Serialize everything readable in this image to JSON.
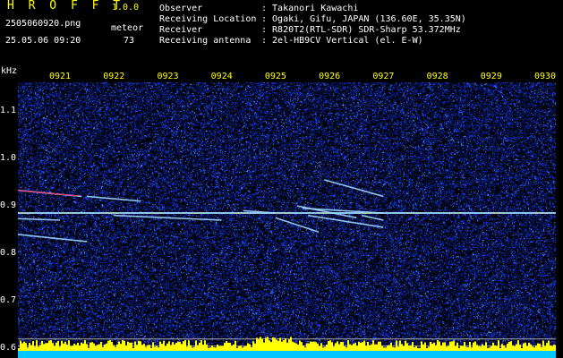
{
  "app": {
    "logo": "H R O F F T",
    "version": "1.0.0",
    "filename": "2505060920.png",
    "datetime": "25.05.06 09:20",
    "meteor_label": "meteor",
    "meteor_count": "73"
  },
  "meta": [
    {
      "label": "Observer",
      "value": ": Takanori Kawachi"
    },
    {
      "label": "Receiving Location",
      "value": ": Ogaki, Gifu, JAPAN (136.60E, 35.35N)"
    },
    {
      "label": "Receiver",
      "value": ": R820T2(RTL-SDR) SDR-Sharp 53.372MHz"
    },
    {
      "label": "Receiving antenna",
      "value": ": 2el-HB9CV Vertical (el. E-W)"
    }
  ],
  "chart_data": {
    "type": "heatmap",
    "ylabel": "kHz",
    "x_ticks": [
      "0921",
      "0922",
      "0923",
      "0924",
      "0925",
      "0926",
      "0927",
      "0928",
      "0929",
      "0930"
    ],
    "y_ticks": [
      "1.1",
      "1.0",
      "0.9",
      "0.8",
      "0.7",
      "0.6"
    ],
    "ylim": [
      0.58,
      1.16
    ],
    "carrier_khz": 0.885,
    "meteor_traces": [
      {
        "t0": 0.92,
        "f0": 0.935,
        "t1": 0.934,
        "f1": 0.92
      },
      {
        "t0": 0.935,
        "f0": 0.92,
        "t1": 0.945,
        "f1": 0.91
      },
      {
        "t0": 0.975,
        "f0": 0.895,
        "t1": 0.99,
        "f1": 0.885
      },
      {
        "t0": 0.918,
        "f0": 0.845,
        "t1": 0.935,
        "f1": 0.825
      },
      {
        "t0": 0.918,
        "f0": 0.875,
        "t1": 0.93,
        "f1": 0.87
      },
      {
        "t0": 0.94,
        "f0": 0.88,
        "t1": 0.96,
        "f1": 0.87
      },
      {
        "t0": 0.964,
        "f0": 0.89,
        "t1": 0.97,
        "f1": 0.885
      },
      {
        "t0": 0.979,
        "f0": 0.955,
        "t1": 0.99,
        "f1": 0.92
      },
      {
        "t0": 0.974,
        "f0": 0.9,
        "t1": 0.985,
        "f1": 0.875
      },
      {
        "t0": 0.976,
        "f0": 0.88,
        "t1": 0.99,
        "f1": 0.855
      },
      {
        "t0": 0.97,
        "f0": 0.875,
        "t1": 0.978,
        "f1": 0.845
      },
      {
        "t0": 0.986,
        "f0": 0.88,
        "t1": 0.99,
        "f1": 0.87
      }
    ],
    "colors": {
      "background": "#000000",
      "noise_dark": "#0a1a6e",
      "noise_mid": "#1c3cff",
      "carrier": "#9fd8ff",
      "echo_hot": "#ff2a6a",
      "echo_warm": "#ffd21a",
      "baseline": "#ffff00",
      "baseline_bottom": "#00c8ff",
      "grid": "#aaaaaa",
      "tick_time": "#ffff00",
      "tick_freq": "#ffffff"
    }
  }
}
